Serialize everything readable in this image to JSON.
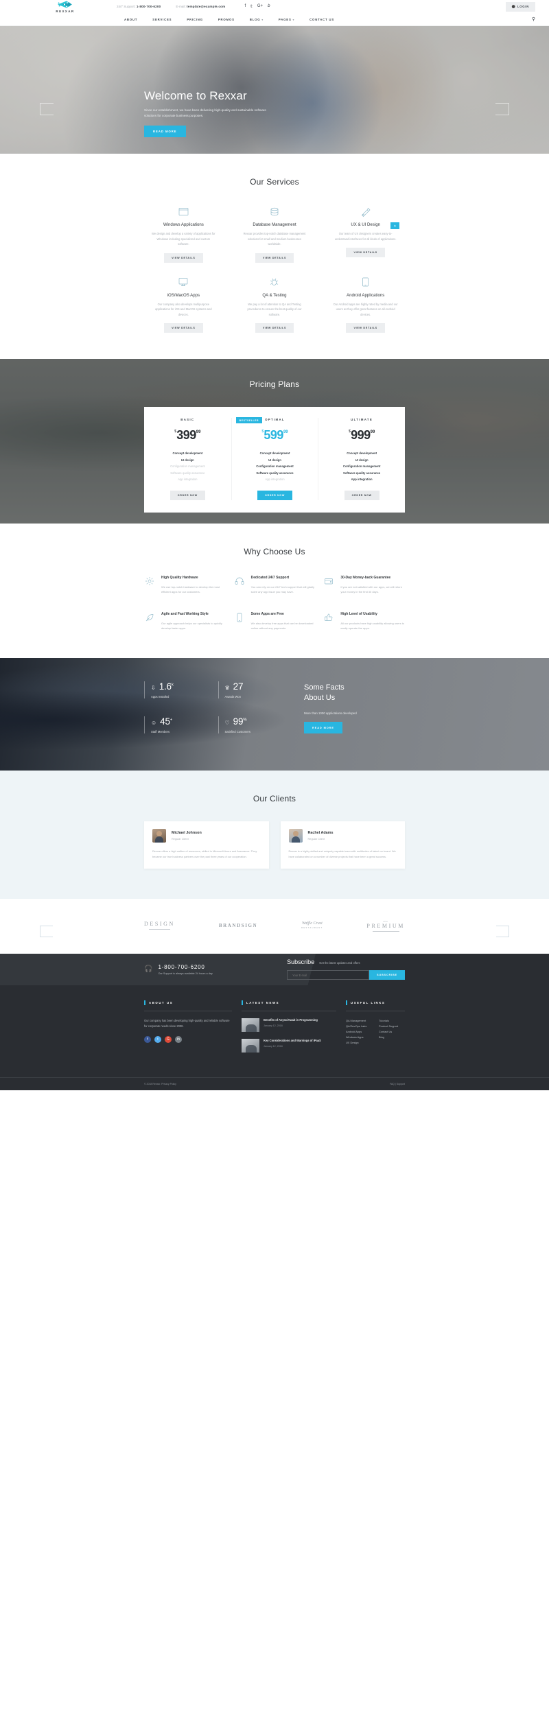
{
  "topbar": {
    "support_label": "24/7 Support:",
    "support_phone": "1-800-700-6200",
    "email_label": "E-mail:",
    "email": "template@example.com",
    "social": [
      "f",
      "𝕥",
      "G+",
      "𝑏"
    ],
    "login_label": "LOGIN",
    "brand_name": "REXXAR"
  },
  "nav": {
    "items": [
      {
        "label": "ABOUT",
        "caret": false
      },
      {
        "label": "SERVICES",
        "caret": false
      },
      {
        "label": "PRICING",
        "caret": false
      },
      {
        "label": "PROMOS",
        "caret": false
      },
      {
        "label": "BLOG",
        "caret": true
      },
      {
        "label": "PAGES",
        "caret": true
      },
      {
        "label": "CONTACT US",
        "caret": false
      }
    ],
    "search_icon": "search-icon"
  },
  "hero": {
    "title": "Welcome to Rexxar",
    "subtitle": "Since our establishment, we have been delivering high-quality and sustainable software solutions for corporate business purposes.",
    "button": "READ MORE"
  },
  "services": {
    "title": "Our Services",
    "scroll_top": "▴",
    "items": [
      {
        "icon": "window-icon",
        "name": "Windows Applications",
        "desc": "We design and develop a variety of applications for Windows including specialized and custom software.",
        "button": "VIEW DETAILS"
      },
      {
        "icon": "database-icon",
        "name": "Database Management",
        "desc": "Rexxar provides top-notch database management solutions for small and medium businesses worldwide.",
        "button": "VIEW DETAILS"
      },
      {
        "icon": "pen-tool-icon",
        "name": "UX & UI Design",
        "desc": "Our team of UX designers creates easy-to-understand interfaces for all kinds of applications.",
        "button": "VIEW DETAILS"
      },
      {
        "icon": "imac-icon",
        "name": "iOS/MacOS Apps",
        "desc": "Our company also develops multipurpose applications for iOS and MacOS systems and devices.",
        "button": "VIEW DETAILS"
      },
      {
        "icon": "bug-icon",
        "name": "QA & Testing",
        "desc": "We pay a lot of attention to QA and Testing procedures to ensure the best quality of our software.",
        "button": "VIEW DETAILS"
      },
      {
        "icon": "tablet-icon",
        "name": "Android Applications",
        "desc": "Our Android apps are highly rated by media and our users as they offer great features on all Android devices.",
        "button": "VIEW DETAILS"
      }
    ]
  },
  "pricing": {
    "title": "Pricing Plans",
    "plans": [
      {
        "name": "BASIC",
        "badge": "",
        "currency": "$",
        "int": "399",
        "dec": "99",
        "features": [
          {
            "text": "Concept development",
            "enabled": true
          },
          {
            "text": "UI design",
            "enabled": true
          },
          {
            "text": "Configuration management",
            "enabled": false
          },
          {
            "text": "Software quality assurance",
            "enabled": false
          },
          {
            "text": "App integration",
            "enabled": false
          }
        ],
        "button": "ORDER NOW",
        "featured": false
      },
      {
        "name": "OPTIMAL",
        "badge": "BESTSELLER",
        "currency": "$",
        "int": "599",
        "dec": "99",
        "features": [
          {
            "text": "Concept development",
            "enabled": true
          },
          {
            "text": "UI design",
            "enabled": true
          },
          {
            "text": "Configuration management",
            "enabled": true
          },
          {
            "text": "Software quality assurance",
            "enabled": true
          },
          {
            "text": "App integration",
            "enabled": false
          }
        ],
        "button": "ORDER NOW",
        "featured": true
      },
      {
        "name": "ULTIMATE",
        "badge": "",
        "currency": "$",
        "int": "999",
        "dec": "99",
        "features": [
          {
            "text": "Concept development",
            "enabled": true
          },
          {
            "text": "UI design",
            "enabled": true
          },
          {
            "text": "Configuration management",
            "enabled": true
          },
          {
            "text": "Software quality assurance",
            "enabled": true
          },
          {
            "text": "App integration",
            "enabled": true
          }
        ],
        "button": "ORDER NOW",
        "featured": false
      }
    ]
  },
  "why": {
    "title": "Why Choose Us",
    "items": [
      {
        "icon": "gear-icon",
        "name": "High Quality Hardware",
        "desc": "We use top-notch hardware to develop the most efficient apps for our customers."
      },
      {
        "icon": "headset-icon",
        "name": "Dedicated 24\\7 Support",
        "desc": "You can rely on our 24/7 tech support that will gladly solve any app issue you may have."
      },
      {
        "icon": "wallet-icon",
        "name": "30-Day Money-back Guarantee",
        "desc": "If you are not satisfied with our apps, we will return your money in the first 30 days."
      },
      {
        "icon": "feather-icon",
        "name": "Agile and Fast Working Style",
        "desc": "Our agile approach helps our specialists to quickly develop faster apps."
      },
      {
        "icon": "mobile-icon",
        "name": "Some Apps are Free",
        "desc": "We also develop free apps that can be downloaded online without any payments."
      },
      {
        "icon": "thumbs-up-icon",
        "name": "High Level of Usability",
        "desc": "All our products have high usability allowing users to easily operate the apps."
      }
    ]
  },
  "facts": {
    "title_line1": "Some Facts",
    "title_line2": "About Us",
    "paragraph": "More than 1000 applications developed",
    "button": "READ MORE",
    "stats": [
      {
        "icon": "download-icon",
        "value": "1.6",
        "suffix": "k",
        "label": "Apps Installed"
      },
      {
        "icon": "trophy-icon",
        "value": "27",
        "suffix": "",
        "label": "Awards Won"
      },
      {
        "icon": "user-icon",
        "value": "45",
        "suffix": "+",
        "label": "Staff Members"
      },
      {
        "icon": "heart-icon",
        "value": "99",
        "suffix": "%",
        "label": "Satisfied Customers"
      }
    ]
  },
  "clients": {
    "title": "Our Clients",
    "testimonials": [
      {
        "name": "Michael Johnson",
        "role": "Regular Client",
        "text": "Rexxar offers a high caliber of resources, skilled in Microsoft Azure and Assurance. They became our true business partners over the past three years of our cooperation."
      },
      {
        "name": "Rachel Adams",
        "role": "Regular Client",
        "text": "Rexxar is a highly skilled and uniquely capable team with multitudes of talent on board. We have collaborated on a number of diverse projects that have been a great success."
      }
    ]
  },
  "brands": [
    {
      "line1": "DESIGN",
      "sub": "",
      "style": "b1"
    },
    {
      "line1": "BRANDSIGN",
      "sub": "",
      "style": "b2"
    },
    {
      "line1": "Waffle Crust",
      "sub": "RESTAURANT",
      "style": "b3"
    },
    {
      "line1": "PREMIUM",
      "sub": "the",
      "style": "b1"
    }
  ],
  "footer": {
    "phone": "1-800-700-6200",
    "phone_note": "Our Support is always available 24 hours a day",
    "subscribe_title": "Subscribe",
    "subscribe_note": "Get the latest updates and offers",
    "email_placeholder": "Your E-mail",
    "subscribe_button": "SUBSCRIBE",
    "about": {
      "title": "ABOUT US",
      "text": "Our company has been developing high-quality and reliable software for corporate needs since 2008.",
      "social": [
        {
          "glyph": "f",
          "color": "#3b5998"
        },
        {
          "glyph": "t",
          "color": "#55acee"
        },
        {
          "glyph": "G",
          "color": "#dd4b39"
        },
        {
          "glyph": "in",
          "color": "#7a8288"
        }
      ]
    },
    "news": {
      "title": "LATEST NEWS",
      "items": [
        {
          "title": "Benefits of Async/Await in Programming",
          "date": "January 12, 2018"
        },
        {
          "title": "Key Considerations and Warnings of iPaaS",
          "date": "January 12, 2018"
        }
      ]
    },
    "links": {
      "title": "USEFUL LINKS",
      "items": [
        "QA Management",
        "Tutorials",
        "QA/DevOps Labs",
        "Product Support",
        "Android Apps",
        "Contact Us",
        "Windows Apps",
        "Blog",
        "UX Design",
        ""
      ]
    },
    "copyright": "© 2018 Rexxar. Privacy Policy",
    "bottom_right": "FAQ  |  Support"
  }
}
